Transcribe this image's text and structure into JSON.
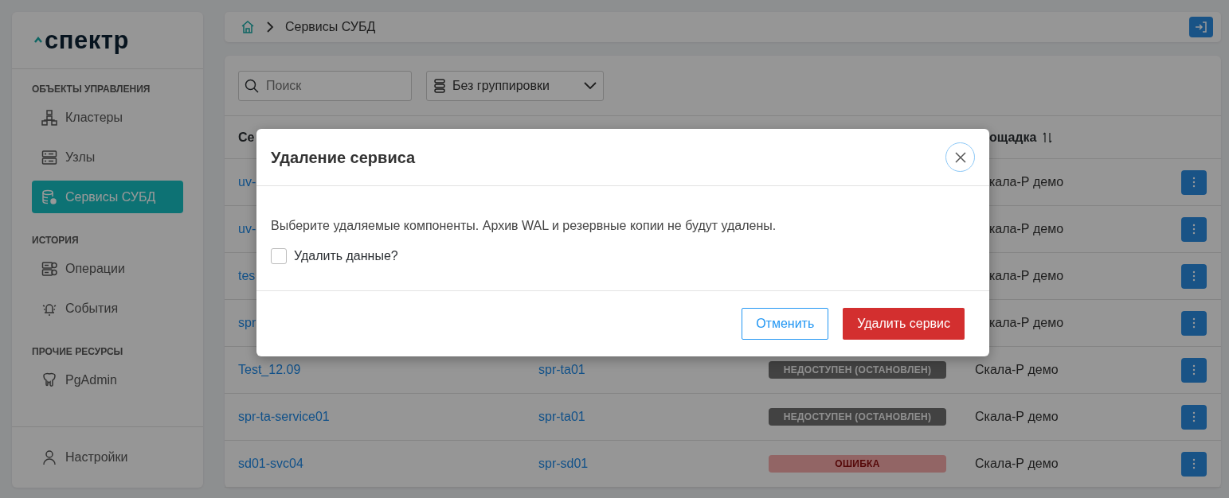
{
  "sidebar": {
    "logo": "спектр",
    "sections": [
      {
        "title": "ОБЪЕКТЫ УПРАВЛЕНИЯ",
        "items": [
          {
            "label": "Кластеры",
            "selected": false
          },
          {
            "label": "Узлы",
            "selected": false
          },
          {
            "label": "Сервисы СУБД",
            "selected": true
          }
        ]
      },
      {
        "title": "ИСТОРИЯ",
        "items": [
          {
            "label": "Операции",
            "selected": false
          },
          {
            "label": "События",
            "selected": false
          }
        ]
      },
      {
        "title": "ПРОЧИЕ РЕСУРСЫ",
        "items": [
          {
            "label": "PgAdmin",
            "selected": false
          }
        ]
      }
    ],
    "footer_item": {
      "label": "Настройки"
    }
  },
  "breadcrumb": {
    "items": [
      "Сервисы СУБД"
    ]
  },
  "toolbar": {
    "search": {
      "placeholder": "Поиск"
    },
    "grouping": {
      "value": "Без группировки"
    }
  },
  "table": {
    "columns": [
      "Се",
      "",
      "",
      "ощадка"
    ],
    "rows": [
      {
        "service": "uv-",
        "platform": "кала-Р демо"
      },
      {
        "service": "uv-",
        "platform": "кала-Р демо"
      },
      {
        "service": "tes",
        "platform": "кала-Р демо"
      },
      {
        "service": "spr",
        "platform": "кала-Р демо"
      },
      {
        "service": "Test_12.09",
        "cluster": "spr-ta01",
        "status": {
          "text": "НЕДОСТУПЕН (ОСТАНОВЛЕН)",
          "kind": "stopped"
        },
        "platform": "Скала-Р демо"
      },
      {
        "service": "spr-ta-service01",
        "cluster": "spr-ta01",
        "status": {
          "text": "НЕДОСТУПЕН (ОСТАНОВЛЕН)",
          "kind": "stopped"
        },
        "platform": "Скала-Р демо"
      },
      {
        "service": "sd01-svc04",
        "cluster": "spr-sd01",
        "status": {
          "text": "ОШИБКА",
          "kind": "error"
        },
        "platform": "Скала-Р демо"
      }
    ]
  },
  "dialog": {
    "title": "Удаление сервиса",
    "message": "Выберите удаляемые компоненты. Архив WAL и резервные копии не будут удалены.",
    "checkbox": {
      "label": "Удалить данные?",
      "checked": false
    },
    "buttons": [
      {
        "label": "Отменить",
        "kind": "secondary"
      },
      {
        "label": "Удалить сервис",
        "kind": "danger"
      }
    ]
  }
}
